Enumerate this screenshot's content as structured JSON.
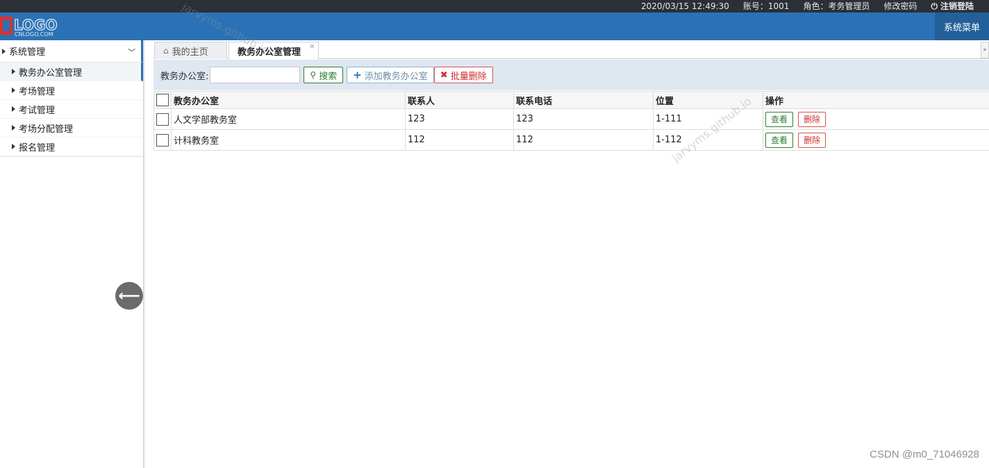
{
  "topbar": {
    "datetime": "2020/03/15 12:49:30",
    "account": "账号：1001",
    "role": "角色：考务管理员",
    "change_password": "修改密码",
    "logout": "注销登陆"
  },
  "header": {
    "logo_text": "LOGO",
    "logo_sub": "CNLOGO.COM",
    "system_menu": "系统菜单"
  },
  "sidebar": {
    "group_label": "系统管理",
    "items": [
      {
        "label": "教务办公室管理"
      },
      {
        "label": "考场管理"
      },
      {
        "label": "考试管理"
      },
      {
        "label": "考场分配管理"
      },
      {
        "label": "报名管理"
      }
    ]
  },
  "tabs": {
    "home": "我的主页",
    "active": "教务办公室管理",
    "close": "×"
  },
  "toolbar": {
    "search_label": "教务办公室:",
    "search_value": "",
    "search_button": "搜索",
    "add_button": "添加教务办公室",
    "batch_delete_button": "批量删除"
  },
  "table": {
    "headers": [
      "教务办公室",
      "联系人",
      "联系电话",
      "位置",
      "操作"
    ],
    "rows": [
      {
        "office": "人文学部教务室",
        "contact": "123",
        "phone": "123",
        "location": "1-111"
      },
      {
        "office": "计科教务室",
        "contact": "112",
        "phone": "112",
        "location": "1-112"
      }
    ],
    "view_label": "查看",
    "delete_label": "删除"
  },
  "watermark": {
    "text": "jarvyms.github.io",
    "csdn": "CSDN @m0_71046928"
  },
  "colors": {
    "header_blue": "#2a72b5",
    "topbar": "#2b2f36",
    "toolbar_bg": "#dfe7f1",
    "green": "#2e7d32",
    "red": "#c9302c"
  }
}
